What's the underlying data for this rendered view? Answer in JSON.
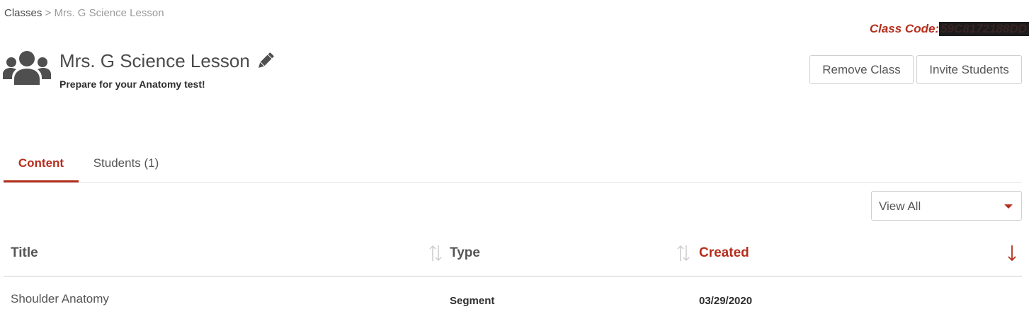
{
  "breadcrumb": {
    "parent": "Classes",
    "separator": ">",
    "current": "Mrs. G Science Lesson"
  },
  "class_code": {
    "label": "Class Code:",
    "value": "59C8172188DD"
  },
  "header": {
    "title": "Mrs. G Science Lesson",
    "subtitle": "Prepare for your Anatomy test!",
    "icons": {
      "group": "users-group-icon",
      "edit": "pencil-icon"
    }
  },
  "actions": {
    "remove_label": "Remove Class",
    "invite_label": "Invite Students"
  },
  "tabs": [
    {
      "label": "Content",
      "active": true
    },
    {
      "label": "Students (1)",
      "active": false
    }
  ],
  "filter": {
    "selected": "View All"
  },
  "table": {
    "columns": [
      {
        "label": "Title",
        "sort": "none"
      },
      {
        "label": "Type",
        "sort": "none"
      },
      {
        "label": "Created",
        "sort": "desc"
      }
    ],
    "rows": [
      {
        "title": "Shoulder Anatomy",
        "type": "Segment",
        "created": "03/29/2020"
      }
    ]
  },
  "colors": {
    "accent": "#b52e1d",
    "text": "#4a4a4a",
    "muted": "#9a9a9a",
    "border": "#cfcfcf"
  }
}
